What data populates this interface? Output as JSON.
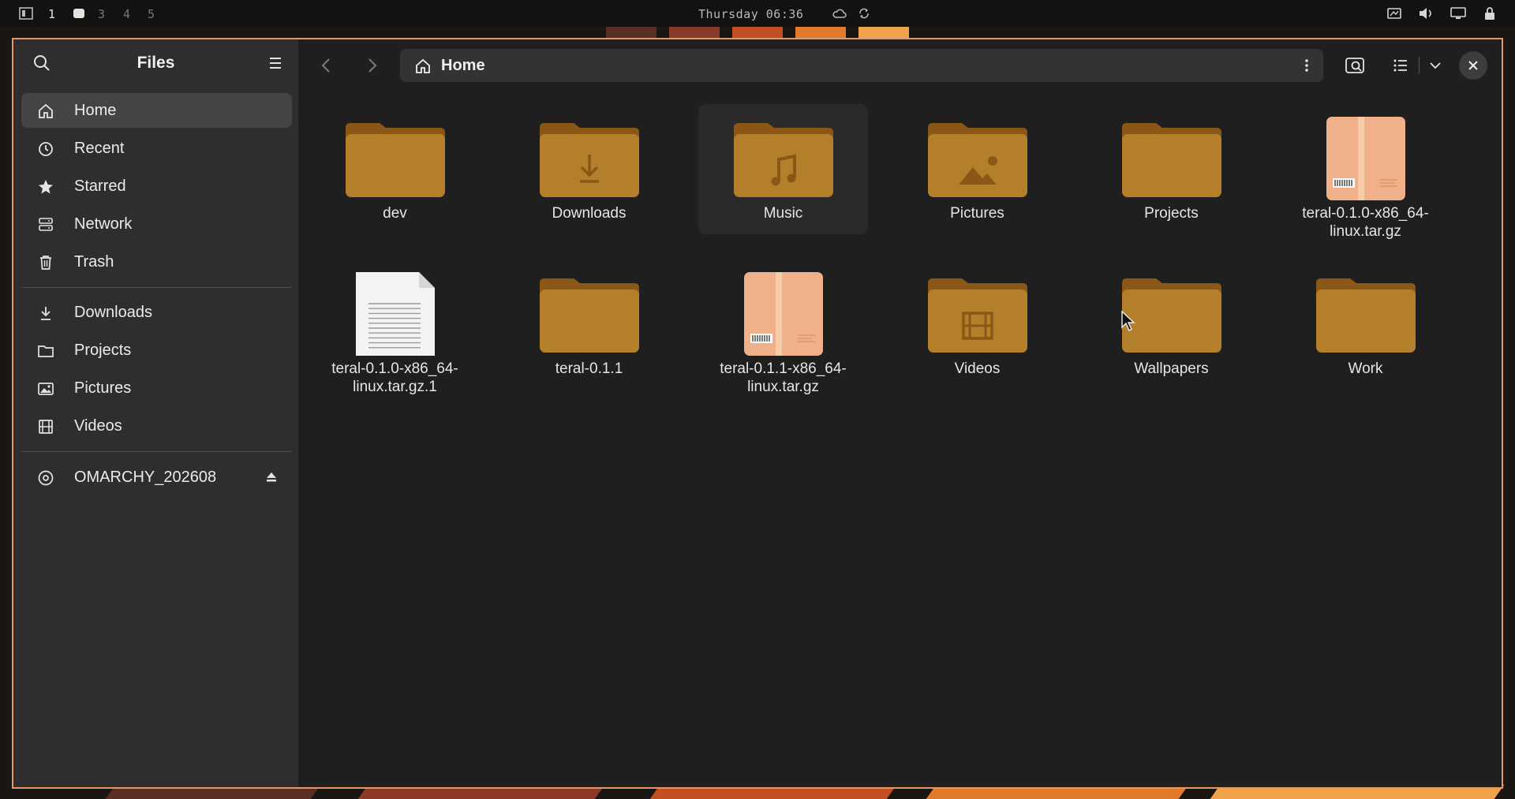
{
  "topbar": {
    "workspaces": [
      "1",
      "3",
      "4",
      "5"
    ],
    "clock": "Thursday 06:36",
    "icons": [
      "layout-icon",
      "active-workspace-icon",
      "cloud-icon",
      "sync-icon",
      "tray-display-icon",
      "volume-icon",
      "monitor-icon",
      "lock-icon"
    ]
  },
  "sidebar": {
    "title": "Files",
    "places": [
      {
        "label": "Home",
        "icon": "home-icon"
      },
      {
        "label": "Recent",
        "icon": "clock-icon"
      },
      {
        "label": "Starred",
        "icon": "star-icon"
      },
      {
        "label": "Network",
        "icon": "network-icon"
      },
      {
        "label": "Trash",
        "icon": "trash-icon"
      }
    ],
    "bookmarks": [
      {
        "label": "Downloads",
        "icon": "download-icon"
      },
      {
        "label": "Projects",
        "icon": "folder-icon"
      },
      {
        "label": "Pictures",
        "icon": "picture-icon"
      },
      {
        "label": "Videos",
        "icon": "video-icon"
      }
    ],
    "devices": [
      {
        "label": "OMARCHY_202608",
        "icon": "disc-icon"
      }
    ]
  },
  "header": {
    "path": "Home"
  },
  "files": [
    {
      "name": "dev",
      "type": "folder"
    },
    {
      "name": "Downloads",
      "type": "folder-downloads"
    },
    {
      "name": "Music",
      "type": "folder-music"
    },
    {
      "name": "Pictures",
      "type": "folder-pictures"
    },
    {
      "name": "Projects",
      "type": "folder"
    },
    {
      "name": "teral-0.1.0-x86_64-linux.tar.gz",
      "type": "archive"
    },
    {
      "name": "teral-0.1.0-x86_64-linux.tar.gz.1",
      "type": "text"
    },
    {
      "name": "teral-0.1.1",
      "type": "folder"
    },
    {
      "name": "teral-0.1.1-x86_64-linux.tar.gz",
      "type": "archive"
    },
    {
      "name": "Videos",
      "type": "folder-videos"
    },
    {
      "name": "Wallpapers",
      "type": "folder"
    },
    {
      "name": "Work",
      "type": "folder"
    }
  ],
  "colors": {
    "accent_border": "#e8956a",
    "folder": "#b47f2a",
    "folder_tab": "#8a5716",
    "archive": "#efb08a"
  }
}
